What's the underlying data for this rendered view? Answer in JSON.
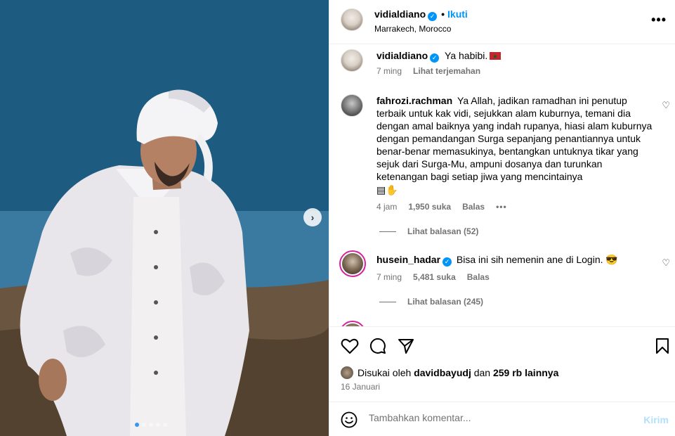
{
  "post": {
    "username": "vidialdiano",
    "follow_label": "Ikuti",
    "separator": "•",
    "location": "Marrakech, Morocco",
    "more_icon": "more-horizontal-icon",
    "carousel": {
      "slide_count": 5,
      "active_index": 0
    }
  },
  "caption": {
    "username": "vidialdiano",
    "text": "Ya habibi.",
    "time": "7 ming",
    "translate_label": "Lihat terjemahan"
  },
  "comments": [
    {
      "username": "fahrozi.rachman",
      "text": "Ya Allah, jadikan ramadhan ini penutup terbaik untuk kak vidi, sejukkan alam kuburnya, temani dia dengan amal baiknya yang indah rupanya, hiasi alam kuburnya dengan pemandangan Surga sepanjang penantiannya untuk benar-benar memasukinya, bentangkan untuknya tikar yang sejuk dari Surga-Mu, ampuni dosanya dan turunkan ketenangan bagi setiap jiwa yang mencintainya",
      "time": "4 jam",
      "likes": "1,950 suka",
      "reply_label": "Balas",
      "replies_label": "Lihat balasan (52)"
    },
    {
      "username": "husein_hadar",
      "text": "Bisa ini sih nemenin ane di Login. 😎",
      "time": "7 ming",
      "likes": "5,481 suka",
      "reply_label": "Balas",
      "replies_label": "Lihat balasan (245)"
    }
  ],
  "likes_summary": {
    "prefix": "Disukai oleh",
    "user": "davidbayudj",
    "and": "dan",
    "others": "259 rb lainnya"
  },
  "date": "16 Januari",
  "add_comment": {
    "placeholder": "Tambahkan komentar...",
    "post_label": "Kirim"
  },
  "colors": {
    "accent": "#0095f6",
    "muted": "#737373",
    "post_disabled": "#b2dffc"
  }
}
